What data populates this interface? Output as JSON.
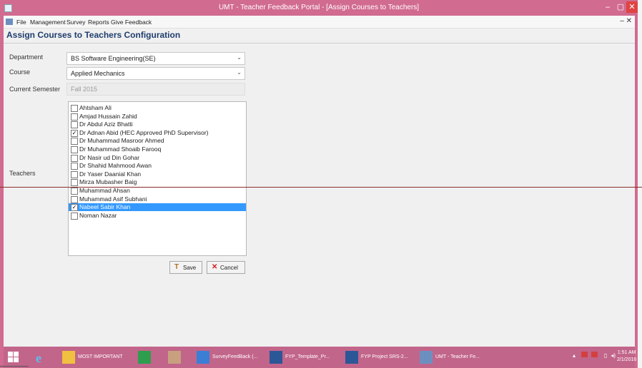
{
  "window": {
    "title": "UMT - Teacher Feedback Portal - [Assign Courses to Teachers]",
    "min_glyph": "–",
    "max_glyph": "▢",
    "close_glyph": "✕",
    "accent_color": "#d16b8f"
  },
  "menubar": {
    "items": [
      "File",
      "Management",
      "Survey",
      "Reports",
      "Give Feedback"
    ],
    "mdi_controls": "– ✕"
  },
  "form": {
    "title": "Assign Courses to Teachers Configuration",
    "department_label": "Department",
    "department_value": "BS Software Engineering(SE)",
    "course_label": "Course",
    "course_value": "Applied Mechanics",
    "semester_label": "Current Semester",
    "semester_value": "Fall 2015",
    "teachers_label": "Teachers",
    "teachers": [
      {
        "name": "Ahtsham Ali",
        "checked": false,
        "selected": false
      },
      {
        "name": "Amjad Hussain Zahid",
        "checked": false,
        "selected": false
      },
      {
        "name": "Dr Abdul Aziz Bhatti",
        "checked": false,
        "selected": false
      },
      {
        "name": "Dr Adnan Abid (HEC Approved PhD Supervisor)",
        "checked": true,
        "selected": false
      },
      {
        "name": "Dr Muhammad Masroor Ahmed",
        "checked": false,
        "selected": false
      },
      {
        "name": "Dr Muhammad Shoaib Farooq",
        "checked": false,
        "selected": false
      },
      {
        "name": "Dr Nasir ud Din Gohar",
        "checked": false,
        "selected": false
      },
      {
        "name": "Dr Shahid Mahmood Awan",
        "checked": false,
        "selected": false
      },
      {
        "name": "Dr Yaser Daanial Khan",
        "checked": false,
        "selected": false
      },
      {
        "name": "Mirza Mubasher Baig",
        "checked": false,
        "selected": false
      },
      {
        "name": "Muhammad Ahsan",
        "checked": false,
        "selected": false
      },
      {
        "name": "Muhammad Asif Subhani",
        "checked": false,
        "selected": false
      },
      {
        "name": "Nabeel Sabir Khan",
        "checked": true,
        "selected": true
      },
      {
        "name": "Noman Nazar",
        "checked": false,
        "selected": false
      }
    ],
    "save_label": "Save",
    "cancel_label": "Cancel"
  },
  "taskbar": {
    "items": [
      {
        "label": "MOST IMPORTANT",
        "icon": "folder-icon",
        "color": "#f0c040"
      },
      {
        "label": "",
        "icon": "store-icon",
        "color": "#2e9e4e"
      },
      {
        "label": "",
        "icon": "tool-icon",
        "color": "#c8a080"
      },
      {
        "label": "SurveyFeedBack (...",
        "icon": "visual-studio-icon",
        "color": "#3a7fd5"
      },
      {
        "label": "FYP_Template_Pr...",
        "icon": "word-icon",
        "color": "#2b5797"
      },
      {
        "label": "FYP Project SRS-2...",
        "icon": "word-icon",
        "color": "#2b5797"
      },
      {
        "label": "UMT - Teacher Fe...",
        "icon": "app-icon",
        "color": "#6d8fbf"
      }
    ],
    "clock_time": "1:51 AM",
    "clock_date": "2/1/2016"
  }
}
